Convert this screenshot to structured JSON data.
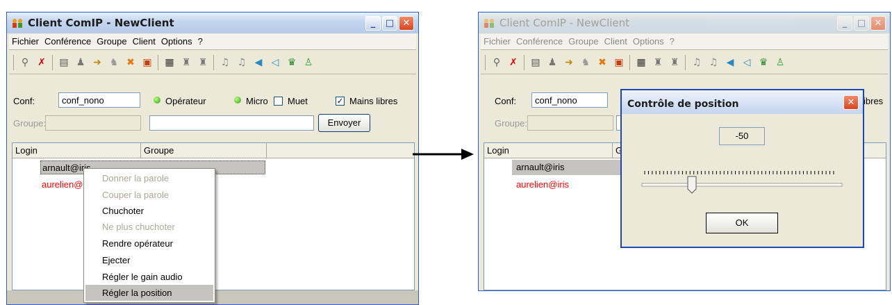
{
  "left_window": {
    "title": "Client ComIP - NewClient",
    "menu": [
      "Fichier",
      "Conférence",
      "Groupe",
      "Client",
      "Options",
      "?"
    ],
    "conf_label": "Conf:",
    "conf_value": "conf_nono",
    "operateur": "Opérateur",
    "micro": "Micro",
    "muet": "Muet",
    "mains_libres": "Mains libres",
    "groupe_label": "Groupe:",
    "send_label": "Envoyer",
    "columns": [
      "Login",
      "Groupe"
    ],
    "rows": [
      "arnault@iris",
      "aurelien@"
    ],
    "context_menu": [
      {
        "label": "Donner la parole",
        "enabled": false
      },
      {
        "label": "Couper la parole",
        "enabled": false
      },
      {
        "label": "Chuchoter",
        "enabled": true
      },
      {
        "label": "Ne plus chuchoter",
        "enabled": false
      },
      {
        "label": "Rendre opérateur",
        "enabled": true
      },
      {
        "label": "Ejecter",
        "enabled": true
      },
      {
        "label": "Régler le gain audio",
        "enabled": true
      },
      {
        "label": "Régler la position",
        "enabled": true,
        "selected": true
      }
    ]
  },
  "right_window": {
    "title": "Client ComIP - NewClient",
    "menu": [
      "Fichier",
      "Conférence",
      "Groupe",
      "Client",
      "Options",
      "?"
    ],
    "conf_label": "Conf:",
    "conf_value": "conf_nono",
    "mains_libres_partial": "ibres",
    "groupe_label": "Groupe:",
    "columns": [
      "Login",
      "G"
    ],
    "rows": [
      "arnault@iris",
      "aurelien@iris"
    ]
  },
  "dialog": {
    "title": "Contrôle de position",
    "value": "-50",
    "slider_fraction": 0.25,
    "ok_label": "OK"
  },
  "colors": {
    "title_bar": "#c5d7ef",
    "red_user": "#ff0000",
    "close_button": "#d9451f"
  }
}
